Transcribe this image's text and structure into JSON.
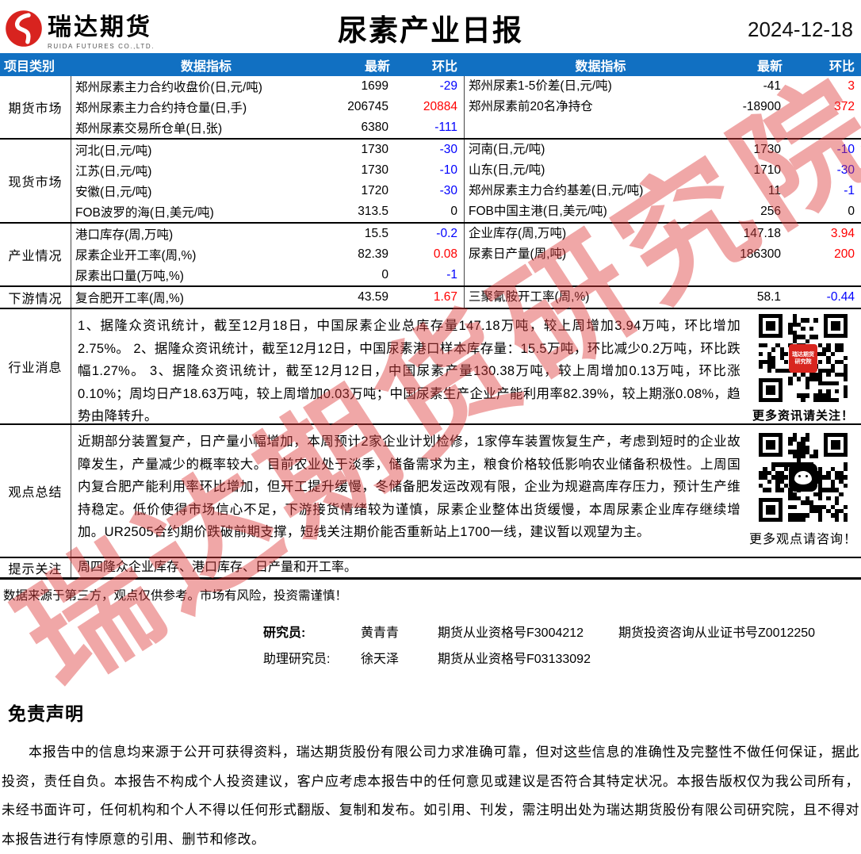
{
  "header": {
    "logo_name": "瑞达期货",
    "logo_sub": "RUIDA FUTURES CO.,LTD.",
    "title": "尿素产业日报",
    "date": "2024-12-18"
  },
  "table": {
    "col_headers": [
      "项目类别",
      "数据指标",
      "最新",
      "环比",
      "数据指标",
      "最新",
      "环比"
    ],
    "sections": [
      {
        "category": "期货市场",
        "rows": [
          {
            "l_label": "郑州尿素主力合约收盘价(日,元/吨)",
            "l_latest": "1699",
            "l_change": "-29",
            "l_color": "#0000fe",
            "r_label": "郑州尿素1-5价差(日,元/吨)",
            "r_latest": "-41",
            "r_change": "3",
            "r_color": "#fe0000"
          },
          {
            "l_label": "郑州尿素主力合约持仓量(日,手)",
            "l_latest": "206745",
            "l_change": "20884",
            "l_color": "#fe0000",
            "r_label": "郑州尿素前20名净持仓",
            "r_latest": "-18900",
            "r_change": "372",
            "r_color": "#fe0000"
          },
          {
            "l_label": "郑州尿素交易所仓单(日,张)",
            "l_latest": "6380",
            "l_change": "-111",
            "l_color": "#0000fe",
            "r_label": "",
            "r_latest": "",
            "r_change": "",
            "r_color": "#000000"
          }
        ]
      },
      {
        "category": "现货市场",
        "rows": [
          {
            "l_label": "河北(日,元/吨)",
            "l_latest": "1730",
            "l_change": "-30",
            "l_color": "#0000fe",
            "r_label": "河南(日,元/吨)",
            "r_latest": "1730",
            "r_change": "-10",
            "r_color": "#0000fe"
          },
          {
            "l_label": "江苏(日,元/吨)",
            "l_latest": "1730",
            "l_change": "-10",
            "l_color": "#0000fe",
            "r_label": "山东(日,元/吨)",
            "r_latest": "1710",
            "r_change": "-30",
            "r_color": "#0000fe"
          },
          {
            "l_label": "安徽(日,元/吨)",
            "l_latest": "1720",
            "l_change": "-30",
            "l_color": "#0000fe",
            "r_label": "郑州尿素主力合约基差(日,元/吨)",
            "r_latest": "11",
            "r_change": "-1",
            "r_color": "#0000fe"
          },
          {
            "l_label": "FOB波罗的海(日,美元/吨)",
            "l_latest": "313.5",
            "l_change": "0",
            "l_color": "#000000",
            "r_label": "FOB中国主港(日,美元/吨)",
            "r_latest": "256",
            "r_change": "0",
            "r_color": "#000000"
          }
        ]
      },
      {
        "category": "产业情况",
        "rows": [
          {
            "l_label": "港口库存(周,万吨)",
            "l_latest": "15.5",
            "l_change": "-0.2",
            "l_color": "#0000fe",
            "r_label": "企业库存(周,万吨)",
            "r_latest": "147.18",
            "r_change": "3.94",
            "r_color": "#fe0000"
          },
          {
            "l_label": "尿素企业开工率(周,%)",
            "l_latest": "82.39",
            "l_change": "0.08",
            "l_color": "#fe0000",
            "r_label": "尿素日产量(周,吨)",
            "r_latest": "186300",
            "r_change": "200",
            "r_color": "#fe0000"
          },
          {
            "l_label": "尿素出口量(万吨,%)",
            "l_latest": "0",
            "l_change": "-1",
            "l_color": "#0000fe",
            "r_label": "",
            "r_latest": "",
            "r_change": "",
            "r_color": "#000000"
          }
        ]
      },
      {
        "category": "下游情况",
        "rows": [
          {
            "l_label": "复合肥开工率(周,%)",
            "l_latest": "43.59",
            "l_change": "1.67",
            "l_color": "#fe0000",
            "r_label": "三聚氰胺开工率(周,%)",
            "r_latest": "58.1",
            "r_change": "-0.44",
            "r_color": "#0000fe"
          }
        ]
      }
    ],
    "news": {
      "category": "行业消息",
      "text": "1、据隆众资讯统计，截至12月18日，中国尿素企业总库存量147.18万吨，较上周增加3.94万吨，环比增加2.75%。 2、据隆众资讯统计，截至12月12日，中国尿素港口样本库存量：15.5万吨，环比减少0.2万吨，环比跌幅1.27%。 3、据隆众资讯统计，截至12月12日，中国尿素产量130.38万吨，较上周增加0.13万吨，环比涨0.10%；周均日产18.63万吨，较上周增加0.03万吨；中国尿素生产企业产能利用率82.39%，较上期涨0.08%，趋势由降转升。",
      "qr_caption": "更多资讯请关注！",
      "qr_badge": "瑞达期货 研究院"
    },
    "opinion": {
      "category": "观点总结",
      "text": "近期部分装置复产，日产量小幅增加，本周预计2家企业计划检修，1家停车装置恢复生产，考虑到短时的企业故障发生，产量减少的概率较大。目前农业处于淡季，储备需求为主，粮食价格较低影响农业储备积极性。上周国内复合肥产能利用率环比增加，但开工提升缓慢，冬储备肥发运改观有限，企业为规避高库存压力，预计生产维持稳定。低价使得市场信心不足，下游接货情绪较为谨慎，尿素企业整体出货缓慢，本周尿素企业库存继续增加。UR2505合约期价跌破前期支撑，短线关注期价能否重新站上1700一线，建议暂以观望为主。",
      "qr_caption": "更多观点请咨询！"
    },
    "alert": {
      "category": "提示关注",
      "text": "周四隆众企业库存、港口库存、日产量和开工率。"
    }
  },
  "footnote": "数据来源于第三方，观点仅供参考。市场有风险，投资需谨慎！",
  "researchers": [
    {
      "role": "研究员:",
      "name": "黄青青",
      "cert": "期货从业资格号F3004212",
      "cert2": "期货投资咨询从业证书号Z0012250"
    },
    {
      "role": "助理研究员:",
      "name": "徐天泽",
      "cert": "期货从业资格号F03133092",
      "cert2": ""
    }
  ],
  "disclaimer": {
    "title": "免责声明",
    "text": "本报告中的信息均来源于公开可获得资料，瑞达期货股份有限公司力求准确可靠，但对这些信息的准确性及完整性不做任何保证，据此投资，责任自负。本报告不构成个人投资建议，客户应考虑本报告中的任何意见或建议是否符合其特定状况。本报告版权仅为我公司所有，未经书面许可，任何机构和个人不得以任何形式翻版、复制和发布。如引用、刊发，需注明出处为瑞达期货股份有限公司研究院，且不得对本报告进行有悖原意的引用、删节和修改。"
  },
  "watermark": "瑞达期货研究院",
  "colors": {
    "header_bg": "#1170c2",
    "up": "#fe0000",
    "down": "#0000fe",
    "logo_red": "#d8231f"
  }
}
